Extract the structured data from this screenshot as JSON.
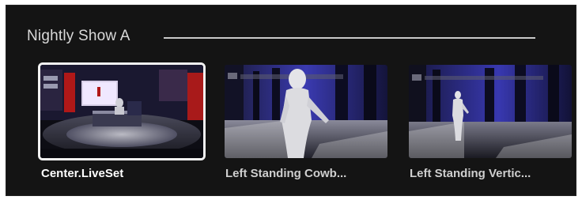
{
  "group": {
    "title": "Nightly Show A"
  },
  "shots": [
    {
      "label": "Center.LiveSet",
      "selected": true,
      "thumbnail": "center-liveset-thumbnail"
    },
    {
      "label": "Left Standing Cowb...",
      "selected": false,
      "thumbnail": "left-standing-cowboy-thumbnail"
    },
    {
      "label": "Left Standing Vertic...",
      "selected": false,
      "thumbnail": "left-standing-vertical-thumbnail"
    }
  ],
  "colors": {
    "panel_bg": "#141414",
    "selection_border": "#f2f2f2",
    "studio_blue": "#2a2a8a",
    "studio_red": "#b01818"
  }
}
